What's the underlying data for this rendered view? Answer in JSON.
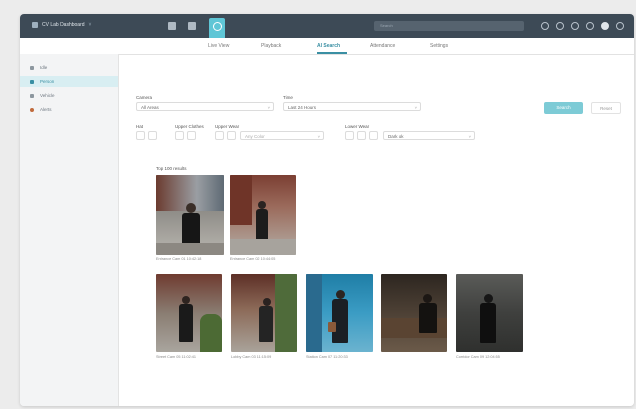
{
  "topbar": {
    "app_title": "CV Lab Dashboard",
    "search_placeholder": "Search"
  },
  "tabs": [
    {
      "label": "Live View"
    },
    {
      "label": "Playback"
    },
    {
      "label": "AI Search",
      "active": true
    },
    {
      "label": "Attendance"
    },
    {
      "label": "Settings"
    }
  ],
  "sidebar": {
    "items": [
      {
        "label": "Idle"
      },
      {
        "label": "Person",
        "active": true
      },
      {
        "label": "Vehicle"
      },
      {
        "label": "Alerts"
      }
    ]
  },
  "filters": {
    "camera_label": "Camera",
    "camera_value": "All Areas",
    "time_label": "Time",
    "time_value": "Last 24 Hours",
    "hat_label": "Hat",
    "upper_label": "Upper Clothes",
    "upper_color_label": "Upper Wear",
    "upper_color_placeholder": "Any Color",
    "lower_label": "Lower Wear",
    "lower_value": "Dark ok",
    "search_button": "Search",
    "reset_button": "Reset"
  },
  "results": {
    "title": "Top 100 results",
    "row1": [
      {
        "caption": "Entrance Cam 01 10:42:18"
      },
      {
        "caption": "Entrance Cam 02 10:44:05"
      }
    ],
    "row2": [
      {
        "caption": "Street Cam 05 11:02:41"
      },
      {
        "caption": "Lobby Cam 03 11:15:09"
      },
      {
        "caption": "Station Cam 07 11:20:33"
      },
      {
        "caption": ""
      },
      {
        "caption": "Corridor Cam 09 12:04:55"
      }
    ]
  },
  "colors": {
    "topbar": "#3d4a56",
    "accent": "#5fc6d6",
    "accent_dark": "#3a8fa3",
    "primary_button": "#7dcbd6"
  }
}
